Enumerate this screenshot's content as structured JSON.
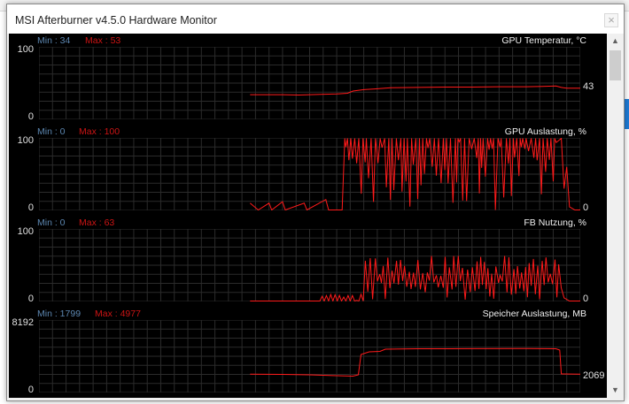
{
  "window": {
    "title": "MSI Afterburner v4.5.0 Hardware Monitor",
    "close_label": "×"
  },
  "background": {
    "blue_tab_color": "#1e7bd6"
  },
  "colors": {
    "trace": "#ff1a1a",
    "grid": "#2b2b2b",
    "min_label": "#5c86b0",
    "max_label": "#cc1414"
  },
  "scrollbar": {
    "up_icon": "▲",
    "down_icon": "▼"
  },
  "graphs": [
    {
      "title": "GPU Temperatur, °C",
      "min_text": "Min : 34",
      "max_text": "Max : 53",
      "y_max_label": "100",
      "y_min_label": "0",
      "y_max": 100,
      "current_text": "43",
      "current_value": 43,
      "series": [
        [
          0.39,
          34
        ],
        [
          0.42,
          34
        ],
        [
          0.45,
          34
        ],
        [
          0.48,
          33.5
        ],
        [
          0.5,
          34
        ],
        [
          0.52,
          34.5
        ],
        [
          0.55,
          35
        ],
        [
          0.57,
          36
        ],
        [
          0.58,
          39
        ],
        [
          0.6,
          41
        ],
        [
          0.62,
          42
        ],
        [
          0.65,
          43.5
        ],
        [
          0.7,
          44
        ],
        [
          0.75,
          44.5
        ],
        [
          0.8,
          44.5
        ],
        [
          0.85,
          45
        ],
        [
          0.9,
          45
        ],
        [
          0.93,
          45.5
        ],
        [
          0.955,
          46
        ],
        [
          0.965,
          44
        ],
        [
          0.975,
          43
        ],
        [
          1,
          43
        ]
      ]
    },
    {
      "title": "GPU Auslastung, %",
      "min_text": "Min : 0",
      "max_text": "Max : 100",
      "y_max_label": "100",
      "y_min_label": "0",
      "y_max": 100,
      "current_text": "0",
      "current_value": 0,
      "series": "gpu_load"
    },
    {
      "title": "FB Nutzung, %",
      "min_text": "Min : 0",
      "max_text": "Max : 63",
      "y_max_label": "100",
      "y_min_label": "0",
      "y_max": 100,
      "current_text": "0",
      "current_value": 0,
      "series": "fb_usage"
    },
    {
      "title": "Speicher Auslastung, MB",
      "min_text": "Min : 1799",
      "max_text": "Max : 4977",
      "y_max_label": "8192",
      "y_min_label": "0",
      "y_max": 8192,
      "current_text": "2069",
      "current_value": 2069,
      "series": [
        [
          0.39,
          2069
        ],
        [
          0.45,
          2050
        ],
        [
          0.5,
          2000
        ],
        [
          0.55,
          1900
        ],
        [
          0.58,
          1850
        ],
        [
          0.59,
          2000
        ],
        [
          0.595,
          4300
        ],
        [
          0.61,
          4600
        ],
        [
          0.63,
          4650
        ],
        [
          0.64,
          4900
        ],
        [
          0.7,
          4950
        ],
        [
          0.8,
          4960
        ],
        [
          0.9,
          4970
        ],
        [
          0.955,
          4950
        ],
        [
          0.962,
          4800
        ],
        [
          0.965,
          2100
        ],
        [
          1,
          2069
        ]
      ]
    }
  ]
}
